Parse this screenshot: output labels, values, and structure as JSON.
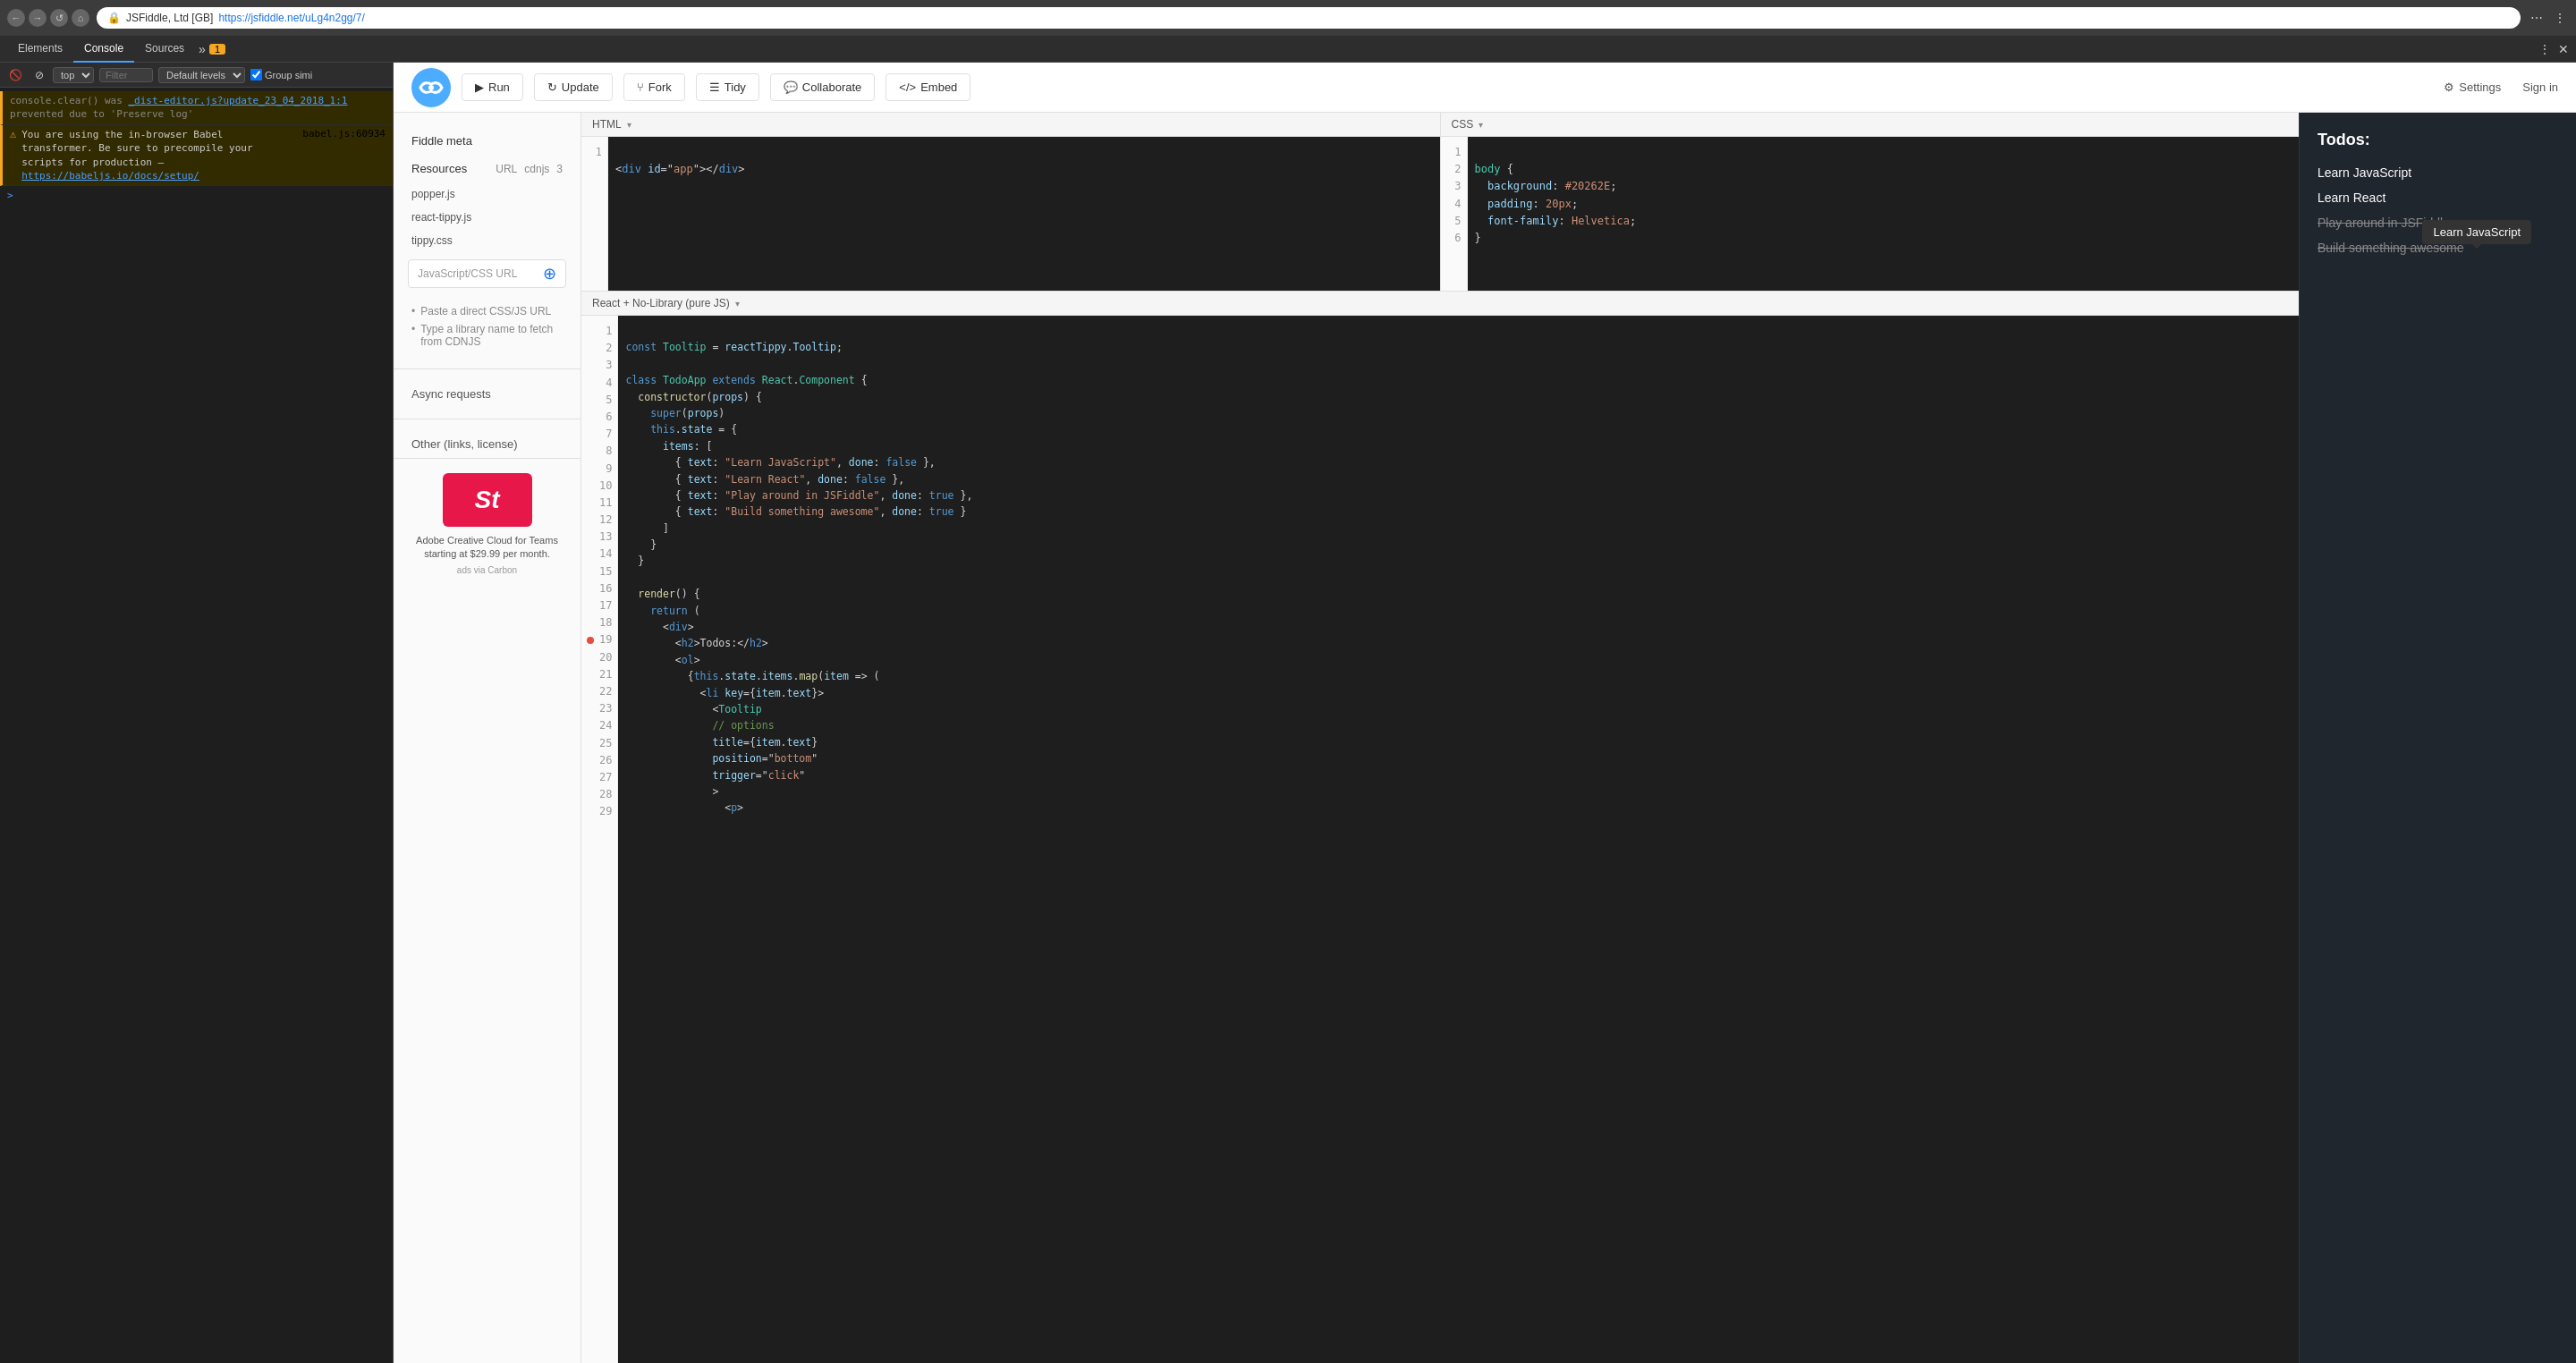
{
  "browser": {
    "back_btn": "←",
    "forward_btn": "→",
    "reload_btn": "↺",
    "home_btn": "⌂",
    "address": "https://jsfiddle.net/uLg4n2gg/7/",
    "lock_icon": "🔒",
    "title": "JSFiddle, Ltd [GB]"
  },
  "devtools": {
    "tabs": [
      "Elements",
      "Console",
      "Sources"
    ],
    "active_tab": "Console",
    "more_label": "»",
    "warn_count": "1",
    "toolbar": {
      "filter_placeholder": "Filter",
      "level_label": "Default levels",
      "group_label": "Group simi"
    },
    "context_select": "top",
    "console_lines": [
      {
        "type": "warn",
        "text": "console.clear() was _dist-editor.js?update_23_04_2018_1:1 prevented due to 'Preserve log'"
      },
      {
        "type": "warn",
        "text": "You are using the in-browser Babel transformer. Be sure to precompile your scripts for production –",
        "link": "babel.js:60934",
        "link2": "https://babeljs.io/docs/setup/"
      }
    ],
    "prompt": ">"
  },
  "jsfiddle": {
    "header": {
      "run_label": "Run",
      "update_label": "Update",
      "fork_label": "Fork",
      "tidy_label": "Tidy",
      "collaborate_label": "Collaborate",
      "embed_label": "Embed",
      "settings_label": "Settings",
      "signin_label": "Sign in"
    },
    "sidebar": {
      "fiddle_meta": "Fiddle meta",
      "resources_label": "Resources",
      "resources_url": "URL",
      "resources_cdnjs": "cdnjs",
      "resources_count": "3",
      "resource_items": [
        "popper.js",
        "react-tippy.js",
        "tippy.css"
      ],
      "url_placeholder": "JavaScript/CSS URL",
      "hint1": "Paste a direct CSS/JS URL",
      "hint2": "Type a library name to fetch from CDNJS",
      "async_requests": "Async requests",
      "other_links": "Other (links, license)",
      "ad": {
        "logo_text": "St",
        "ad_text": "Adobe Creative Cloud for Teams starting at $29.99 per month.",
        "via": "ads via Carbon"
      }
    },
    "html_editor": {
      "label": "HTML",
      "lines": [
        "1"
      ],
      "code": "<div id=\"app\"></div>"
    },
    "css_editor": {
      "label": "CSS",
      "lines": [
        "1",
        "2",
        "3",
        "4",
        "5",
        "6"
      ],
      "code_lines": [
        "body {",
        "  background: #20262E;",
        "  padding: 20px;",
        "  font-family: Helvetica;",
        "}"
      ]
    },
    "js_editor": {
      "label": "React + No-Library (pure JS)",
      "lines": [
        "1",
        "2",
        "3",
        "4",
        "5",
        "6",
        "7",
        "8",
        "9",
        "10",
        "11",
        "12",
        "13",
        "14",
        "15",
        "16",
        "17",
        "18",
        "19",
        "20",
        "21",
        "22",
        "23",
        "24",
        "25",
        "26",
        "27",
        "28",
        "29"
      ],
      "error_line": 19,
      "code_lines": [
        "const Tooltip = reactTippy.Tooltip;",
        "",
        "class TodoApp extends React.Component {",
        "  constructor(props) {",
        "    super(props)",
        "    this.state = {",
        "      items: [",
        "        { text: \"Learn JavaScript\", done: false },",
        "        { text: \"Learn React\", done: false },",
        "        { text: \"Play around in JSFiddle\", done: true },",
        "        { text: \"Build something awesome\", done: true }",
        "      ]",
        "    }",
        "  }",
        "",
        "  render() {",
        "    return (",
        "      <div>",
        "        <h2>Todos:</h2>",
        "        <ol>",
        "          {this.state.items.map(item => (",
        "            <li key={item.text}>",
        "              <Tooltip",
        "              // options",
        "              title={item.text}",
        "              position=\"bottom\"",
        "              trigger=\"click\"",
        "              >",
        "                <p>"
      ]
    },
    "result": {
      "title": "Todos:",
      "items": [
        {
          "text": "Learn JavaScript",
          "done": false
        },
        {
          "text": "Learn React",
          "done": false
        },
        {
          "text": "Play around in JSFiddle",
          "done": true
        },
        {
          "text": "Build something awesome",
          "done": true
        }
      ],
      "tooltip_text": "Learn JavaScript"
    }
  }
}
